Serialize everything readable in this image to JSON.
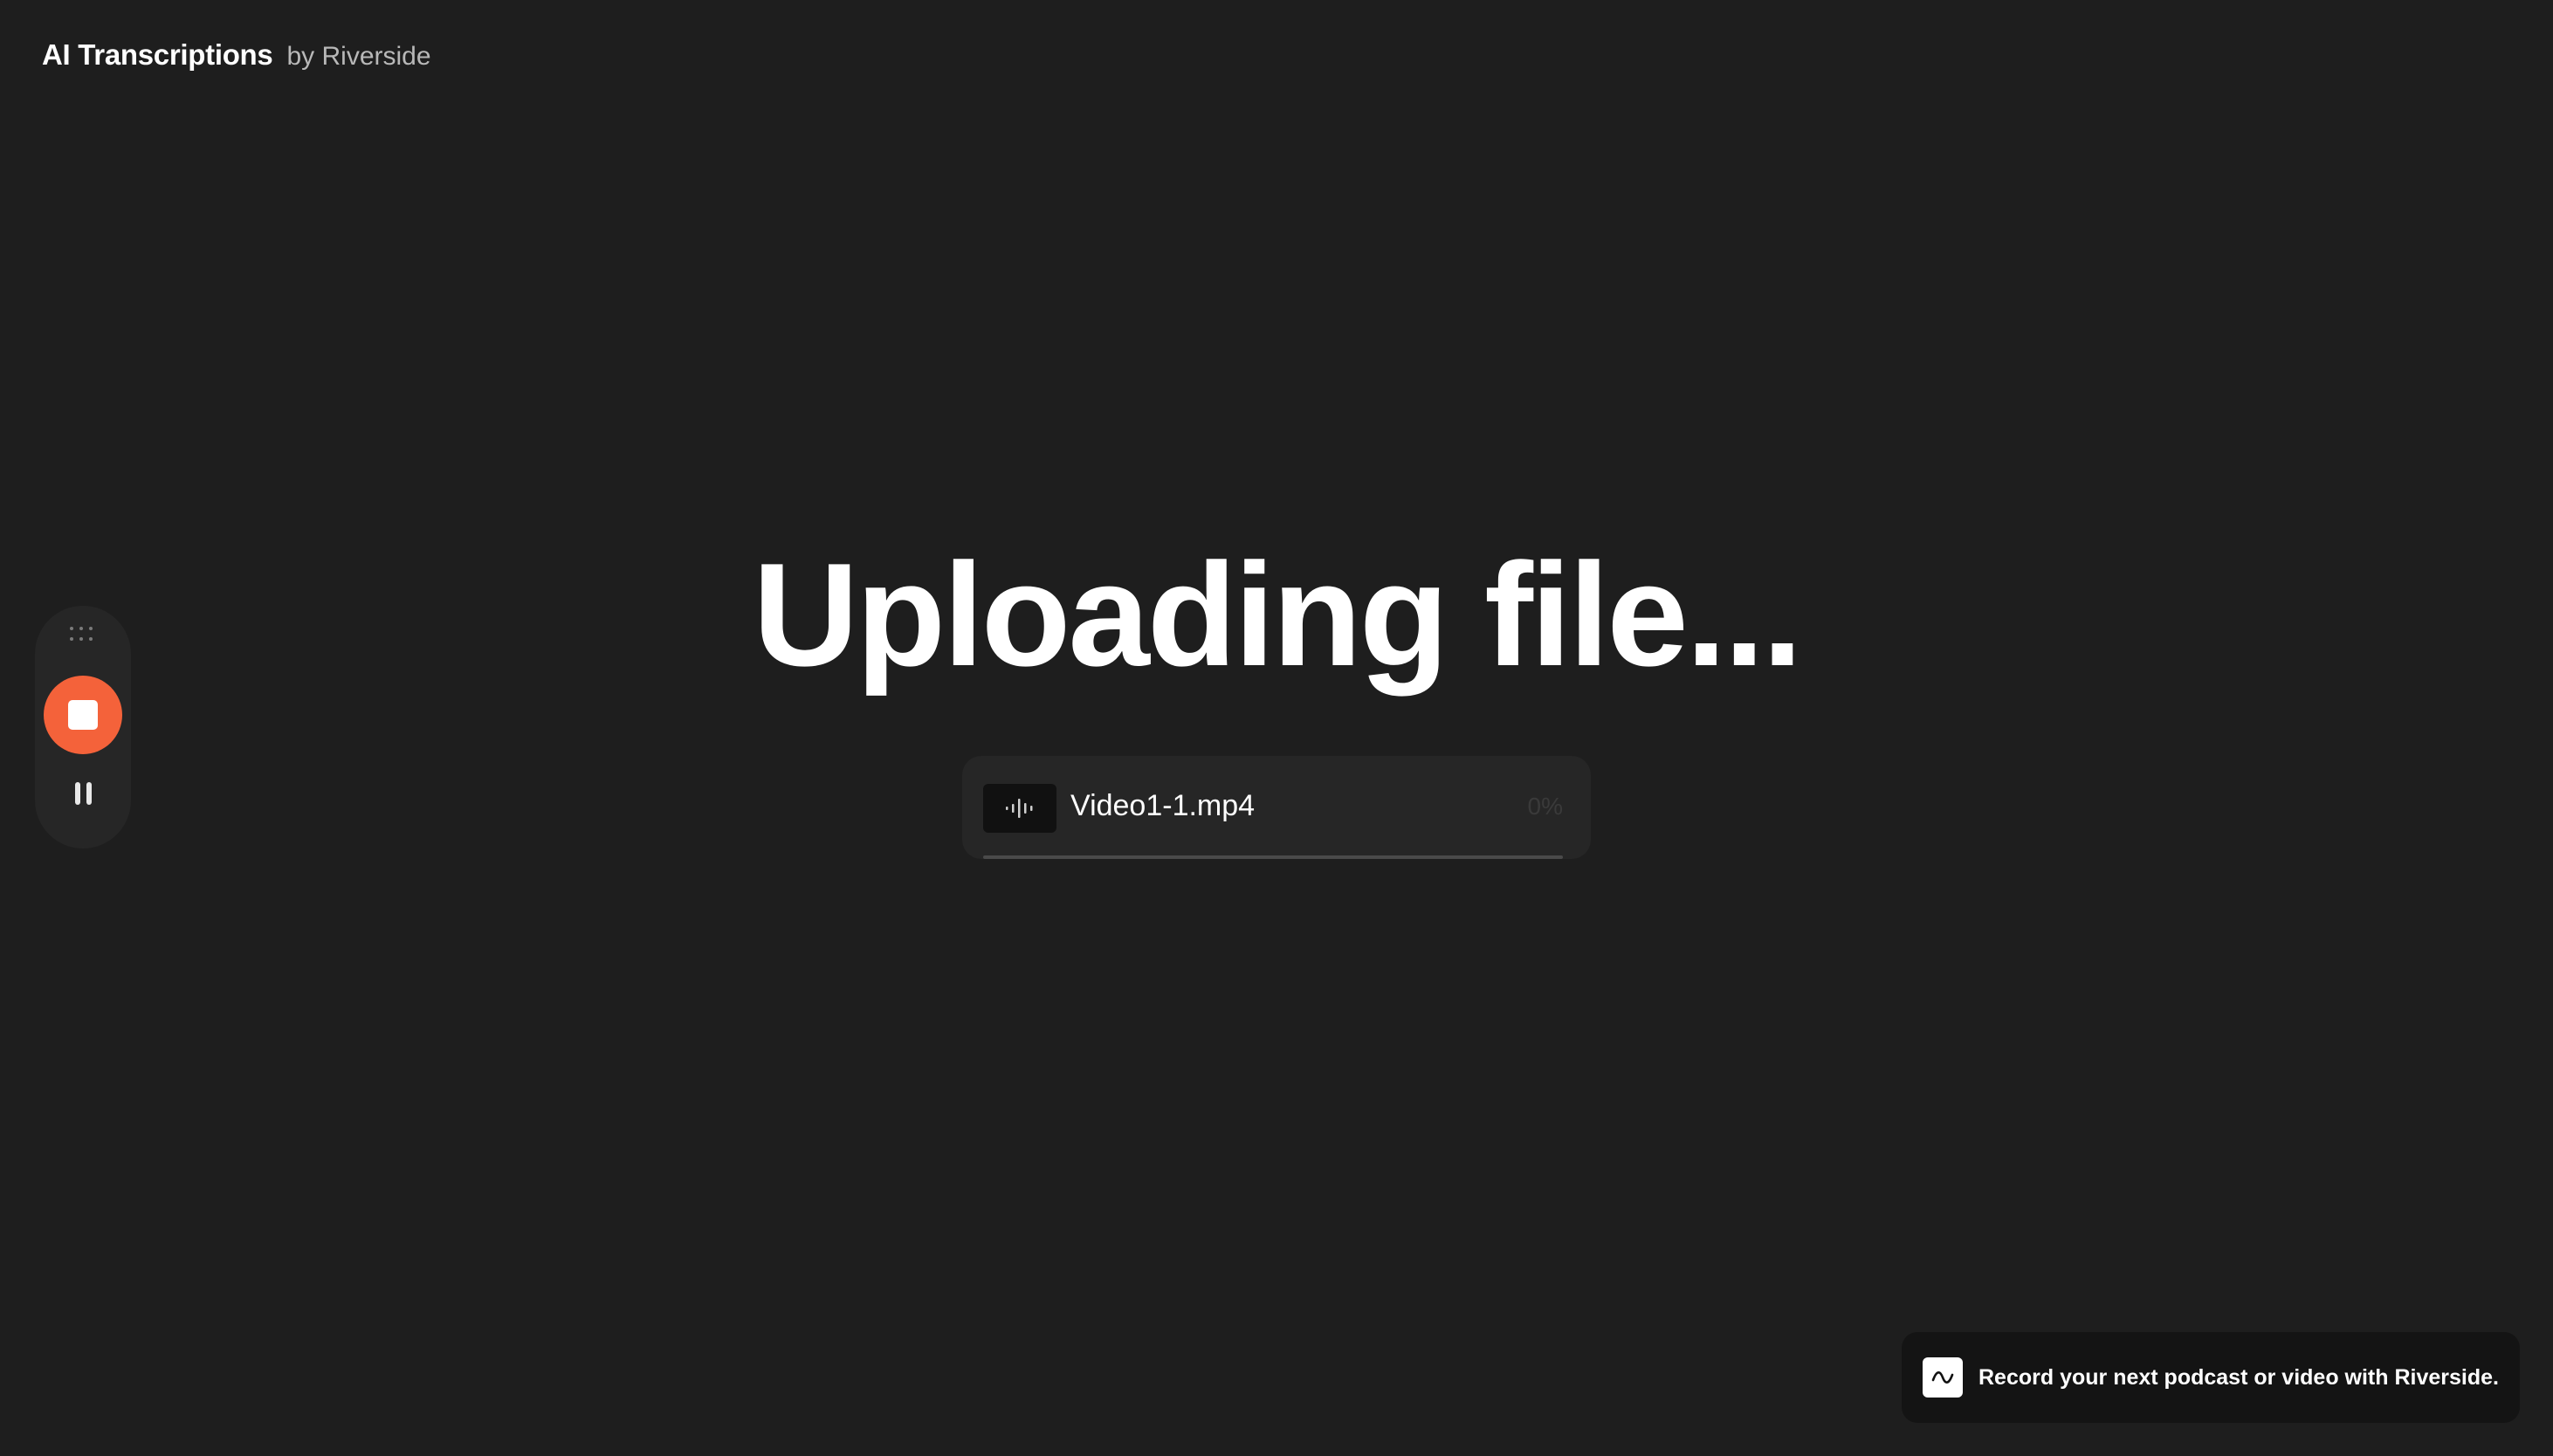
{
  "header": {
    "title": "AI Transcriptions",
    "subtitle": "by Riverside"
  },
  "recorder": {
    "drag_icon": "drag-handle-icon",
    "stop_icon": "stop-icon",
    "pause_icon": "pause-icon",
    "stop_color": "#f4623a"
  },
  "main": {
    "heading": "Uploading file..."
  },
  "upload": {
    "file_icon": "audio-waveform-icon",
    "file_name": "Video1-1.mp4",
    "progress_label": "0%",
    "progress_percent": 0
  },
  "promo": {
    "logo_icon": "riverside-logo-icon",
    "text": "Record your next podcast or video with Riverside."
  },
  "colors": {
    "background": "#1e1e1e",
    "card": "#262626",
    "accent": "#f4623a"
  }
}
